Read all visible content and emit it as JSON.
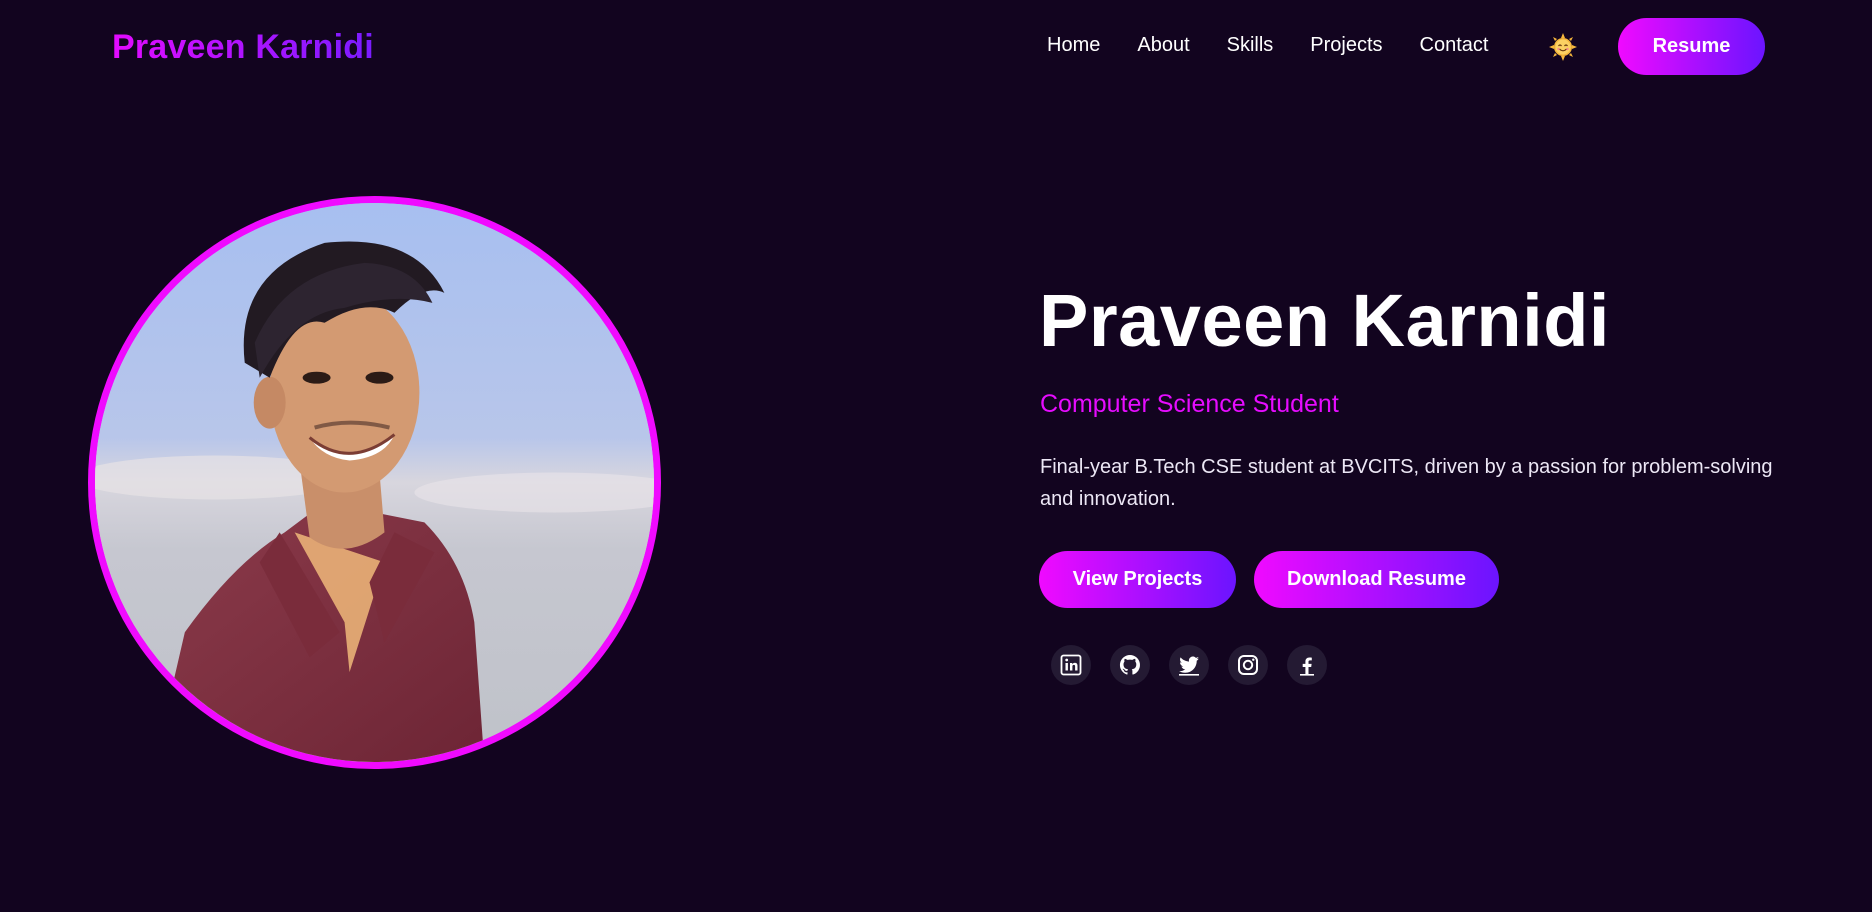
{
  "header": {
    "logo": "Praveen Karnidi",
    "nav": [
      {
        "label": "Home"
      },
      {
        "label": "About"
      },
      {
        "label": "Skills"
      },
      {
        "label": "Projects"
      },
      {
        "label": "Contact"
      }
    ],
    "theme_toggle_icon": "sun-face-icon",
    "resume_label": "Resume"
  },
  "hero": {
    "name": "Praveen Karnidi",
    "role": "Computer Science Student",
    "description": "Final-year B.Tech CSE student at BVCITS, driven by a passion for problem-solving and innovation.",
    "buttons": {
      "view_projects": "View Projects",
      "download_resume": "Download Resume"
    },
    "socials": [
      {
        "icon": "linkedin-icon"
      },
      {
        "icon": "github-icon"
      },
      {
        "icon": "twitter-icon"
      },
      {
        "icon": "instagram-icon"
      },
      {
        "icon": "facebook-icon"
      }
    ]
  },
  "colors": {
    "background": "#12041f",
    "accent": "#f00aff",
    "accent_end": "#6b14ff",
    "social_bg": "#241a33"
  }
}
